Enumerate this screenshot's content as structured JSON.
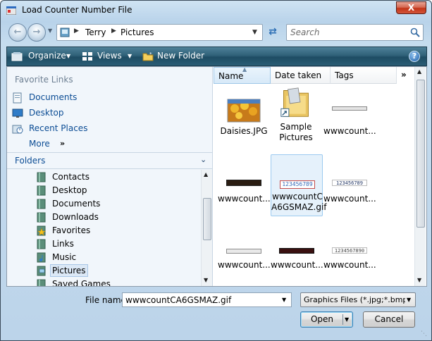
{
  "window": {
    "title": "Load Counter Number File",
    "close_label": "X"
  },
  "address": {
    "breadcrumbs": [
      "Terry",
      "Pictures"
    ]
  },
  "search": {
    "placeholder": "Search"
  },
  "toolbar": {
    "organize_label": "Organize",
    "views_label": "Views",
    "new_folder_label": "New Folder",
    "help_label": "?"
  },
  "favorite_links": {
    "header": "Favorite Links",
    "items": [
      {
        "label": "Documents",
        "icon": "documents-icon"
      },
      {
        "label": "Desktop",
        "icon": "desktop-icon"
      },
      {
        "label": "Recent Places",
        "icon": "recent-places-icon"
      },
      {
        "label": "More",
        "icon": ""
      }
    ],
    "more_arrows": "»"
  },
  "folders": {
    "header": "Folders",
    "items": [
      {
        "label": "Contacts"
      },
      {
        "label": "Desktop"
      },
      {
        "label": "Documents"
      },
      {
        "label": "Downloads"
      },
      {
        "label": "Favorites"
      },
      {
        "label": "Links"
      },
      {
        "label": "Music"
      },
      {
        "label": "Pictures",
        "selected": true
      },
      {
        "label": "Saved Games"
      }
    ]
  },
  "columns": [
    "Name",
    "Date taken",
    "Tags"
  ],
  "column_more": "»",
  "files": [
    {
      "name": "Daisies.JPG",
      "kind": "photo"
    },
    {
      "name": "Sample Pictures",
      "kind": "folder"
    },
    {
      "name": "wwwcount...",
      "kind": "counter-plain"
    },
    {
      "name": "wwwcount...",
      "kind": "counter-red"
    },
    {
      "name": "wwwcountCA6GSMAZ.gif",
      "name_line1": "wwwcountC",
      "name_line2": "A6GSMAZ.gif",
      "kind": "counter-outline",
      "selected": true,
      "digits": "123456789"
    },
    {
      "name": "wwwcount...",
      "kind": "counter-digits",
      "digits": "123456789"
    },
    {
      "name": "wwwcount...",
      "kind": "counter-gray"
    },
    {
      "name": "wwwcount...",
      "kind": "counter-darkred"
    },
    {
      "name": "wwwcount...",
      "kind": "counter-text",
      "digits": "1234567890"
    }
  ],
  "file_name": {
    "label": "File name:",
    "value": "wwwcountCA6GSMAZ.gif"
  },
  "file_type": {
    "value": "Graphics Files (*.jpg;*.bmp;*.g"
  },
  "buttons": {
    "open": "Open",
    "cancel": "Cancel"
  },
  "colors": {
    "toolbar": "#2f6178",
    "link": "#0b4c94",
    "selection": "#e5f1fb",
    "close": "#c23418"
  }
}
